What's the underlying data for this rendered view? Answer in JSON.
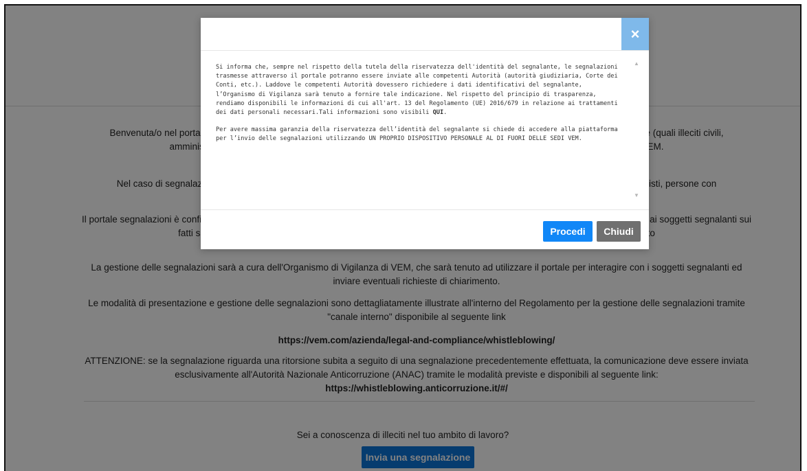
{
  "page": {
    "paragraphs": [
      "Benvenuta/o nel portale segnalazioni di VEM. Il portale consente di segnalare violazioni di disposizioni normative di diritto nazionale (quali illeciti civili, amministrativi, penali, contabili) o europeo, nonché violazioni del Modello di organizzazione e gestione adottato da VEM.",
      "Nel caso di segnalazione, possono effettuare segnalazioni dipendenti, collaboratori, consulenti, fornitori, liberi professionisti, azionisti, persone con",
      "Il portale segnalazioni è configurato in modo da garantire, in ogni fase del processo di segnalazione, il massimo rispetto della riservatezza ai soggetti segnalanti sui fatti segnalati e sull'identità dei soggetti coinvolti. Si consiglia dunque di utilizzare il presente portale come strumento",
      "La gestione delle segnalazioni sarà a cura dell'Organismo di Vigilanza di VEM, che sarà tenuto ad utilizzare il portale per interagire con i soggetti segnalanti ed inviare eventuali richieste di chiarimento.",
      "Le modalità di presentazione e gestione delle segnalazioni sono dettagliatamente illustrate all'interno del Regolamento per la gestione delle segnalazioni tramite \"canale interno\" disponibile al seguente link"
    ],
    "link_vem": "https://vem.com/azienda/legal-and-compliance/whistleblowing/",
    "attention": "ATTENZIONE: se la segnalazione riguarda una ritorsione subita a seguito di una segnalazione precedentemente effettuata, la comunicazione deve essere inviata esclusivamente all'Autorità Nazionale Anticorruzione (ANAC) tramite le modalità previste e disponibili al seguente link:",
    "link_anac": "https://whistleblowing.anticorruzione.it/#/",
    "question": "Sei a conoscenza di illeciti nel tuo ambito di lavoro?",
    "report_button": "Invia una segnalazione"
  },
  "modal": {
    "close_label": "×",
    "p1_before": "Si informa che, sempre nel rispetto della tutela della riservatezza dell'identità del segnalante, le segnalazioni trasmesse attraverso il portale potranno essere inviate alle competenti Autorità (autorità giudiziaria, Corte dei Conti, etc.). Laddove le competenti Autorità dovessero richiedere i dati identificativi del segnalante, l’Organismo di Vigilanza sarà tenuto a fornire tale indicazione. Nel rispetto del principio di trasparenza, rendiamo disponibili le informazioni di cui all'art. 13 del Regolamento (UE) 2016/679 in relazione ai trattamenti dei dati personali necessari.Tali informazioni sono visibili ",
    "p1_link": "QUI",
    "p1_after": ".",
    "p2": "Per avere massima garanzia della riservatezza dell’identità del segnalante si chiede di accedere alla piattaforma per l’invio delle segnalazioni utilizzando UN PROPRIO DISPOSITIVO PERSONALE AL DI FUORI DELLE SEDI VEM.",
    "procedi": "Procedi",
    "chiudi": "Chiudi"
  }
}
